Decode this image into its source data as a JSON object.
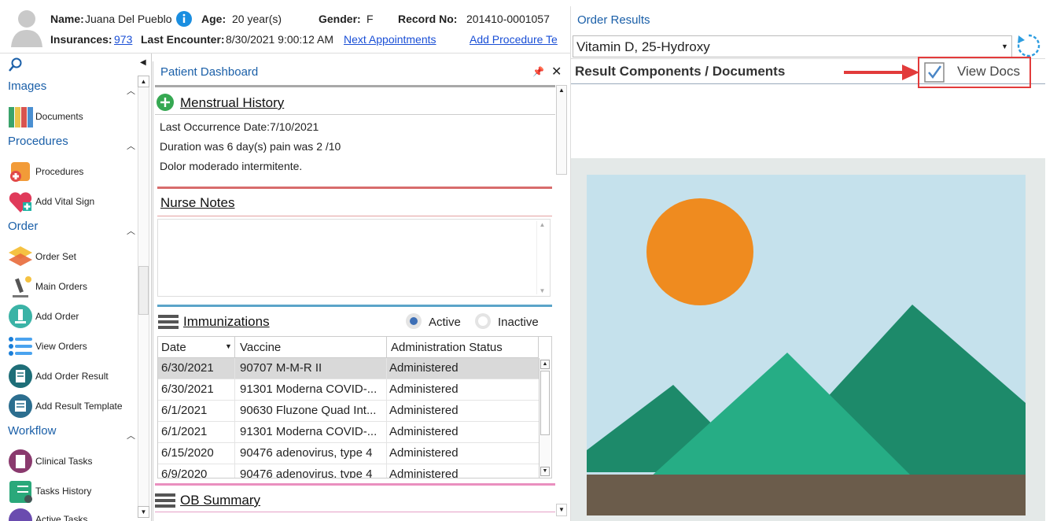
{
  "header": {
    "name_label": "Name:",
    "name_value": "Juana Del Pueblo",
    "age_label": "Age:",
    "age_value": "20 year(s)",
    "gender_label": "Gender:",
    "gender_value": "F",
    "record_label": "Record No:",
    "record_value": "201410-0001057",
    "insurances_label": "Insurances:",
    "insurances_value": "973",
    "last_encounter_label": "Last Encounter:",
    "last_encounter_value": "8/30/2021 9:00:12 AM",
    "next_appointments": "Next Appointments",
    "add_procedure": "Add Procedure Te"
  },
  "sidebar": {
    "sections": [
      {
        "title": "Images"
      },
      {
        "title": "Procedures"
      },
      {
        "title": "Order"
      },
      {
        "title": "Workflow"
      }
    ],
    "items": [
      {
        "label": "Documents",
        "icon": "documents-icon"
      },
      {
        "label": "Procedures",
        "icon": "procedures-icon"
      },
      {
        "label": "Add Vital Sign",
        "icon": "vital-sign-icon"
      },
      {
        "label": "Order Set",
        "icon": "order-set-icon"
      },
      {
        "label": "Main Orders",
        "icon": "microscope-icon"
      },
      {
        "label": "Add Order",
        "icon": "add-order-icon"
      },
      {
        "label": "View Orders",
        "icon": "view-orders-icon"
      },
      {
        "label": "Add Order Result",
        "icon": "order-result-icon"
      },
      {
        "label": "Add Result Template",
        "icon": "result-template-icon"
      },
      {
        "label": "Clinical Tasks",
        "icon": "clinical-tasks-icon"
      },
      {
        "label": "Tasks History",
        "icon": "tasks-history-icon"
      },
      {
        "label": "Active Tasks",
        "icon": "active-tasks-icon"
      }
    ]
  },
  "dashboard": {
    "title": "Patient Dashboard",
    "menstrual": {
      "title": "Menstrual History",
      "lines": [
        "Last Occurrence Date:7/10/2021",
        "Duration was 6 day(s) pain was 2 /10",
        "Dolor moderado intermitente."
      ]
    },
    "nurse_notes": {
      "title": "Nurse Notes"
    },
    "immunizations": {
      "title": "Immunizations",
      "active_label": "Active",
      "inactive_label": "Inactive",
      "columns": [
        "Date",
        "Vaccine",
        "Administration Status"
      ],
      "rows": [
        {
          "date": "6/30/2021",
          "vaccine": "90707 M-M-R II",
          "status": "Administered"
        },
        {
          "date": "6/30/2021",
          "vaccine": "91301 Moderna COVID-...",
          "status": "Administered"
        },
        {
          "date": "6/1/2021",
          "vaccine": "90630 Fluzone Quad Int...",
          "status": "Administered"
        },
        {
          "date": "6/1/2021",
          "vaccine": "91301 Moderna COVID-...",
          "status": "Administered"
        },
        {
          "date": "6/15/2020",
          "vaccine": "90476 adenovirus, type 4",
          "status": "Administered"
        },
        {
          "date": "6/9/2020",
          "vaccine": "90476 adenovirus, type 4",
          "status": "Administered"
        }
      ]
    },
    "ob_summary": {
      "title": "OB Summary"
    }
  },
  "right": {
    "title": "Order Results",
    "select_value": "Vitamin D, 25-Hydroxy",
    "section_title": "Result Components / Documents",
    "view_docs_label": "View Docs"
  },
  "colors": {
    "accent": "#1a5fa8",
    "highlight": "#e23b3b",
    "sky": "#c5e1ec",
    "sun": "#ef8b1f",
    "mountain_dark": "#1d8a6a",
    "mountain_light": "#26ad85",
    "ground": "#6b5c4b"
  }
}
